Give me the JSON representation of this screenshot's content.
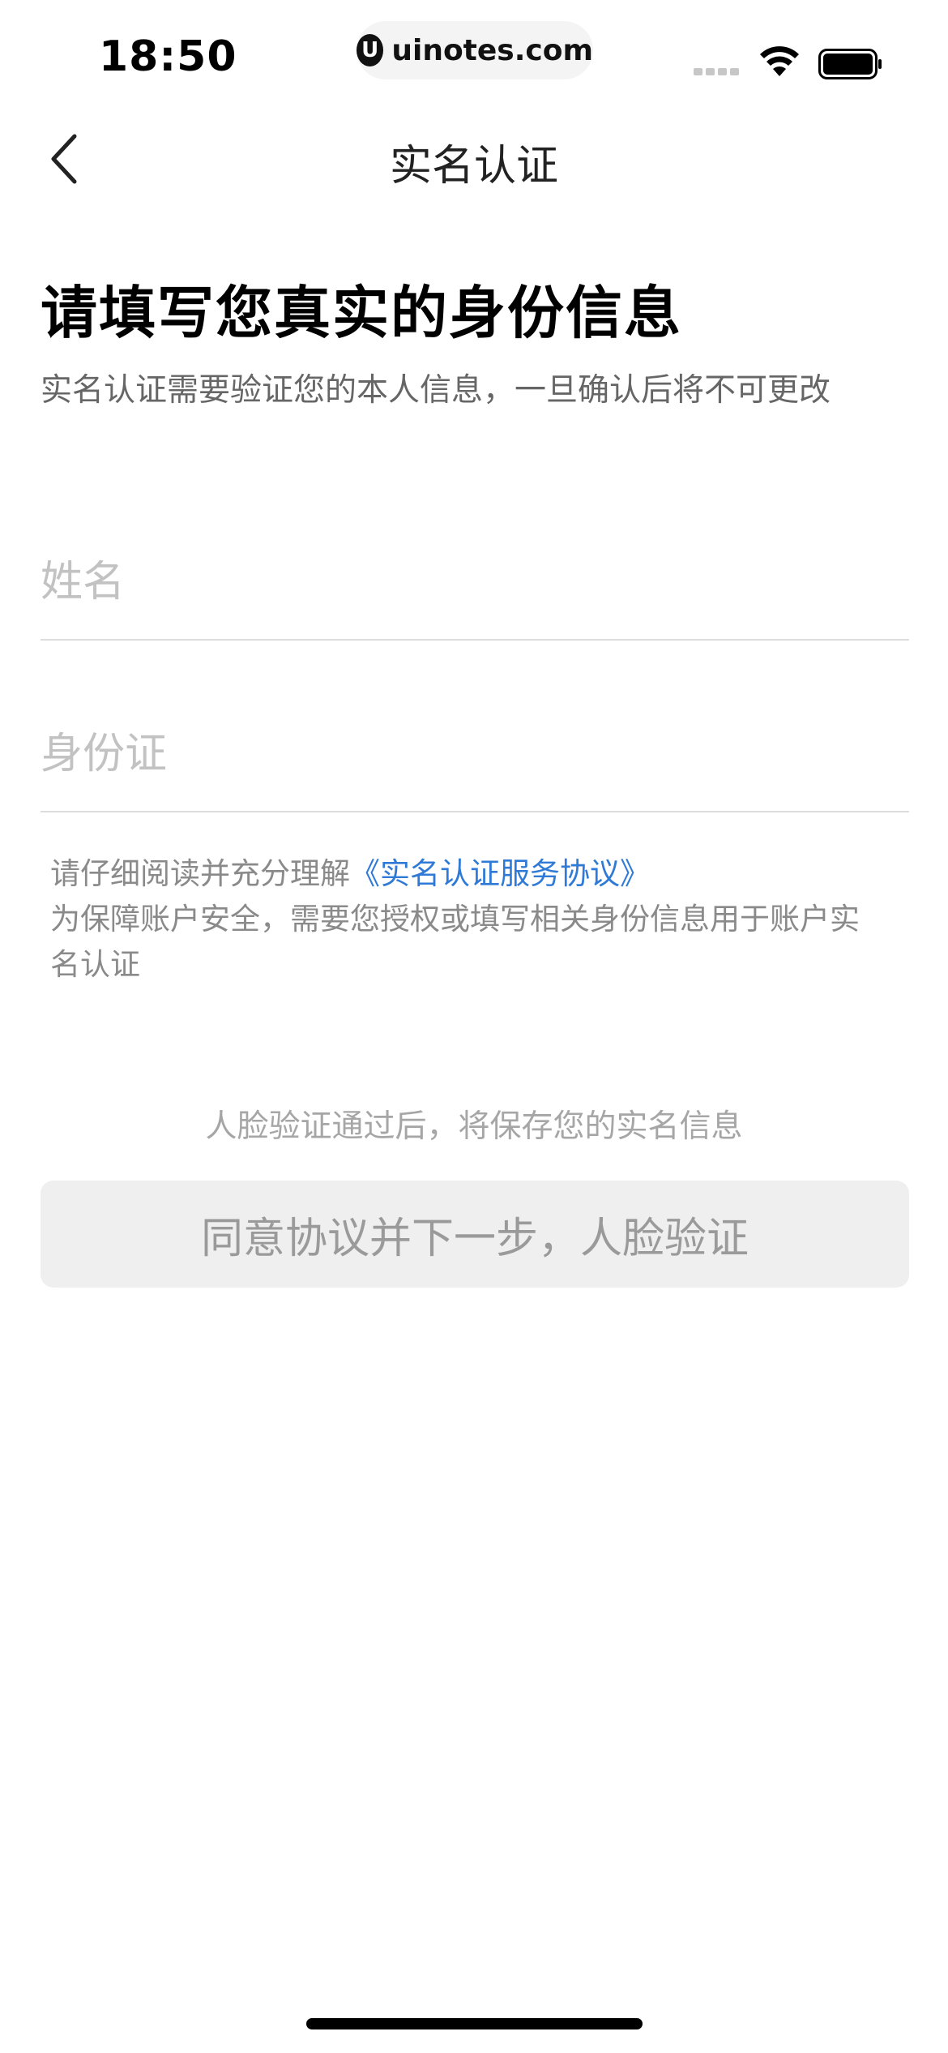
{
  "status_bar": {
    "time": "18:50",
    "url": "uinotes.com",
    "url_logo": "U"
  },
  "nav": {
    "title": "实名认证",
    "back_icon": "chevron-left-icon"
  },
  "main": {
    "heading": "请填写您真实的身份信息",
    "subtitle": "实名认证需要验证您的本人信息，一旦确认后将不可更改",
    "name_placeholder": "姓名",
    "name_value": "",
    "id_placeholder": "身份证",
    "id_value": "",
    "notice_prefix": "请仔细阅读并充分理解",
    "notice_link": "《实名认证服务协议》",
    "notice_line2": "为保障账户安全，需要您授权或填写相关身份信息用于账户实",
    "notice_line3": "名认证",
    "hint": "人脸验证通过后，将保存您的实名信息",
    "cta_label": "同意协议并下一步，人脸验证"
  },
  "colors": {
    "link": "#2f7ad6",
    "button_bg": "#efefef",
    "button_text": "#9a9a9a"
  }
}
